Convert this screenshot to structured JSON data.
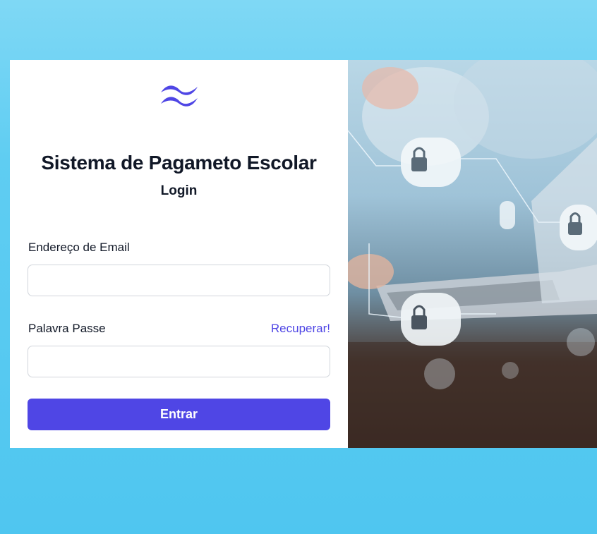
{
  "brand": {
    "logo_icon": "wave-logo-icon",
    "accent_color": "#4f46e5"
  },
  "header": {
    "title": "Sistema de Pagameto Escolar",
    "subtitle": "Login"
  },
  "form": {
    "email_label": "Endereço de Email",
    "email_value": "",
    "password_label": "Palavra Passe",
    "password_value": "",
    "recover_label": "Recuperar!",
    "submit_label": "Entrar"
  },
  "side_image": {
    "icon": "cybersecurity-laptop-image"
  }
}
